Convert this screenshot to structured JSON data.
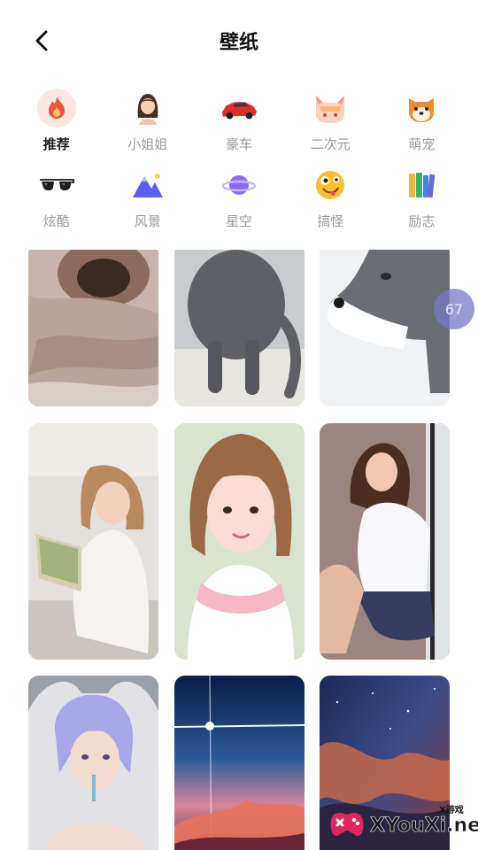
{
  "header": {
    "title": "壁纸",
    "back_icon": "chevron-left-icon"
  },
  "categories": [
    {
      "label": "推荐",
      "icon": "flame-icon",
      "active": true
    },
    {
      "label": "小姐姐",
      "icon": "girl-icon",
      "active": false
    },
    {
      "label": "豪车",
      "icon": "car-icon",
      "active": false
    },
    {
      "label": "二次元",
      "icon": "anime-cat-icon",
      "active": false
    },
    {
      "label": "萌宠",
      "icon": "shiba-icon",
      "active": false
    },
    {
      "label": "炫酷",
      "icon": "sunglasses-icon",
      "active": false
    },
    {
      "label": "风景",
      "icon": "mountain-icon",
      "active": false
    },
    {
      "label": "星空",
      "icon": "planet-icon",
      "active": false
    },
    {
      "label": "搞怪",
      "icon": "silly-face-icon",
      "active": false
    },
    {
      "label": "励志",
      "icon": "books-icon",
      "active": false
    }
  ],
  "wallpapers": [
    {
      "subject": "pug-under-blanket"
    },
    {
      "subject": "grey-cat"
    },
    {
      "subject": "husky-in-snow"
    },
    {
      "subject": "girl-reading-book"
    },
    {
      "subject": "girl-sailor-uniform"
    },
    {
      "subject": "girl-sitting-window"
    },
    {
      "subject": "cosplay-blue-hair"
    },
    {
      "subject": "sky-light-beam"
    },
    {
      "subject": "starry-nebula"
    }
  ],
  "floating_badge": {
    "value": "67"
  },
  "watermark": {
    "text": "XYouXi.net",
    "small": "X游戏"
  },
  "colors": {
    "active_bg": "#fde7e3",
    "inactive_label": "#999999",
    "active_label": "#222222"
  }
}
